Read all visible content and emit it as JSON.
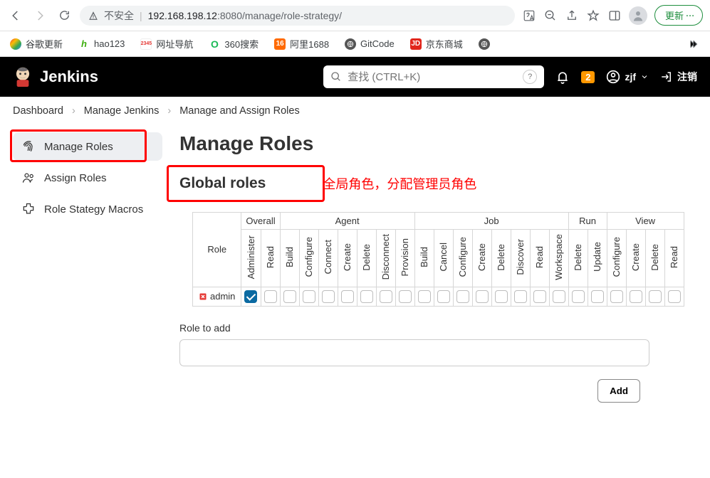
{
  "browser": {
    "url_prefix": "不安全",
    "url_host": "192.168.198.12",
    "url_port_path": ":8080/manage/role-strategy/",
    "update": "更新"
  },
  "bookmarks": [
    {
      "label": "谷歌更新"
    },
    {
      "label": "hao123"
    },
    {
      "label": "网址导航"
    },
    {
      "label": "360搜索"
    },
    {
      "label": "阿里1688"
    },
    {
      "label": "GitCode"
    },
    {
      "label": "京东商城"
    }
  ],
  "header": {
    "brand": "Jenkins",
    "search_placeholder": "查找 (CTRL+K)",
    "notif_count": "2",
    "user": "zjf",
    "logout": "注销"
  },
  "crumbs": [
    "Dashboard",
    "Manage Jenkins",
    "Manage and Assign Roles"
  ],
  "sidebar": {
    "items": [
      {
        "label": "Manage Roles"
      },
      {
        "label": "Assign Roles"
      },
      {
        "label": "Role Stategy Macros"
      }
    ]
  },
  "page": {
    "title": "Manage Roles",
    "section": "Global roles",
    "annotation": "全局角色，分配管理员角色",
    "role_header": "Role",
    "groups": [
      {
        "name": "Overall",
        "perms": [
          "Administer",
          "Read"
        ]
      },
      {
        "name": "Agent",
        "perms": [
          "Build",
          "Configure",
          "Connect",
          "Create",
          "Delete",
          "Disconnect",
          "Provision"
        ]
      },
      {
        "name": "Job",
        "perms": [
          "Build",
          "Cancel",
          "Configure",
          "Create",
          "Delete",
          "Discover",
          "Read",
          "Workspace"
        ]
      },
      {
        "name": "Run",
        "perms": [
          "Delete",
          "Update"
        ]
      },
      {
        "name": "View",
        "perms": [
          "Configure",
          "Create",
          "Delete",
          "Read"
        ]
      }
    ],
    "rows": [
      {
        "name": "admin",
        "checked_first": true
      }
    ],
    "add_label": "Role to add",
    "add_button": "Add"
  }
}
